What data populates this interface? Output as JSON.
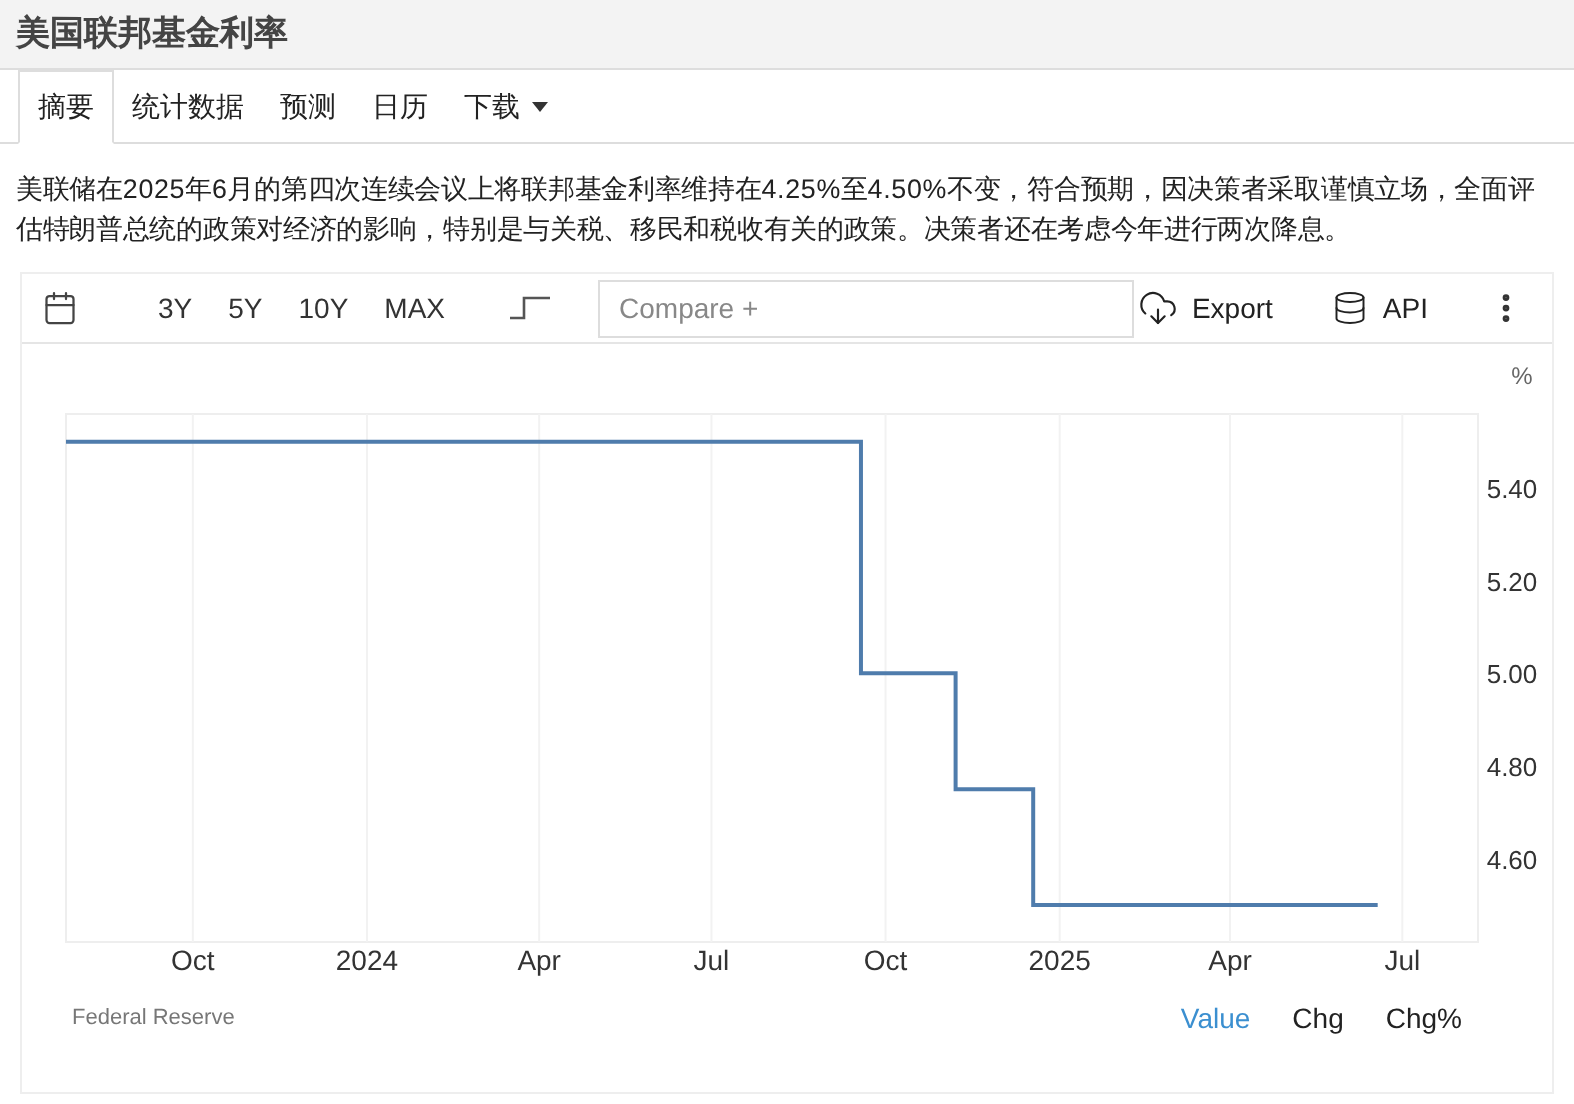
{
  "page_title": "美国联邦基金利率",
  "tabs": [
    {
      "label": "摘要",
      "selected": true
    },
    {
      "label": "统计数据",
      "selected": false
    },
    {
      "label": "预测",
      "selected": false
    },
    {
      "label": "日历",
      "selected": false
    },
    {
      "label": "下载",
      "selected": false,
      "kind": "dropdown"
    }
  ],
  "summary": "美联储在2025年6月的第四次连续会议上将联邦基金利率维持在4.25%至4.50%不变，符合预期，因决策者采取谨慎立场，全面评估特朗普总统的政策对经济的影响，特别是与关税、移民和税收有关的政策。决策者还在考虑今年进行两次降息。",
  "toolbar": {
    "ranges": [
      "3Y",
      "5Y",
      "10Y",
      "MAX"
    ],
    "compare_placeholder": "Compare +",
    "export": "Export",
    "api": "API"
  },
  "chart": {
    "unit": "%",
    "source": "Federal Reserve",
    "modes": [
      {
        "label": "Value",
        "selected": true
      },
      {
        "label": "Chg",
        "selected": false
      },
      {
        "label": "Chg%",
        "selected": false
      }
    ],
    "chart_data": {
      "type": "line",
      "grid": true,
      "x": [
        "2023-07-26",
        "2024-09-18",
        "2024-09-18",
        "2024-11-07",
        "2024-11-07",
        "2024-12-18",
        "2024-12-18",
        "2025-06-18"
      ],
      "series": [
        {
          "color": "#4f7cac",
          "values": [
            5.5,
            5.5,
            5.0,
            5.0,
            4.75,
            4.75,
            4.5,
            4.5
          ]
        }
      ],
      "xlim": [
        "2023-07-26",
        "2025-08-10"
      ],
      "ylim": [
        4.42,
        5.56
      ],
      "xticks": [
        {
          "value": "2023-10-01",
          "label": "Oct"
        },
        {
          "value": "2024-01-01",
          "label": "2024"
        },
        {
          "value": "2024-04-01",
          "label": "Apr"
        },
        {
          "value": "2024-07-01",
          "label": "Jul"
        },
        {
          "value": "2024-10-01",
          "label": "Oct"
        },
        {
          "value": "2025-01-01",
          "label": "2025"
        },
        {
          "value": "2025-04-01",
          "label": "Apr"
        },
        {
          "value": "2025-07-01",
          "label": "Jul"
        }
      ],
      "yticks": [
        {
          "value": 4.6,
          "label": "4.60"
        },
        {
          "value": 4.8,
          "label": "4.80"
        },
        {
          "value": 5.0,
          "label": "5.00"
        },
        {
          "value": 5.2,
          "label": "5.20"
        },
        {
          "value": 5.4,
          "label": "5.40"
        }
      ]
    }
  }
}
